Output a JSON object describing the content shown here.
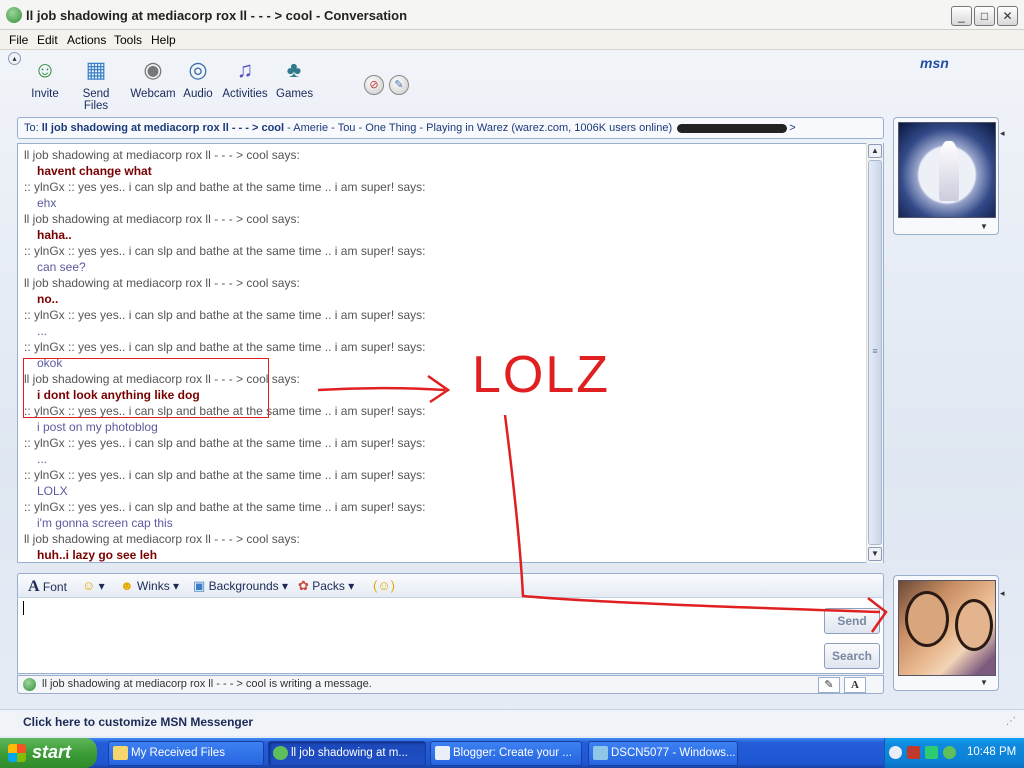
{
  "window": {
    "title": "ll job shadowing at mediacorp rox ll  - - - > cool - Conversation"
  },
  "menu": [
    "File",
    "Edit",
    "Actions",
    "Tools",
    "Help"
  ],
  "toolbar": {
    "items": [
      {
        "label": "Invite",
        "icon": "invite-icon"
      },
      {
        "label": "Send Files",
        "icon": "send-files-icon"
      },
      {
        "label": "Webcam",
        "icon": "webcam-icon"
      },
      {
        "label": "Audio",
        "icon": "audio-icon"
      },
      {
        "label": "Activities",
        "icon": "activities-icon"
      },
      {
        "label": "Games",
        "icon": "games-icon"
      }
    ],
    "logo": "msn"
  },
  "to_bar": {
    "prefix": "To:",
    "name": "ll job shadowing at mediacorp rox ll  - - - > cool",
    "rest": "- Amerie - Tou - One Thing - Playing in Warez (warez.com, 1006K users online)"
  },
  "conversation": [
    {
      "sender": "ll job shadowing at mediacorp rox ll - - - > cool says:",
      "text": "havent change what",
      "bold": true
    },
    {
      "sender": ":: ylnGx :: yes yes.. i can slp and bathe at the same time .. i am super! says:",
      "text": "ehx",
      "bold": false
    },
    {
      "sender": "ll job shadowing at mediacorp rox ll - - - > cool says:",
      "text": "haha..",
      "bold": true
    },
    {
      "sender": ":: ylnGx :: yes yes.. i can slp and bathe at the same time .. i am super! says:",
      "text": "can see?",
      "bold": false
    },
    {
      "sender": "ll job shadowing at mediacorp rox ll - - - > cool says:",
      "text": "no..",
      "bold": true
    },
    {
      "sender": ":: ylnGx :: yes yes.. i can slp and bathe at the same time .. i am super! says:",
      "text": "...",
      "bold": false
    },
    {
      "sender": ":: ylnGx :: yes yes.. i can slp and bathe at the same time .. i am super! says:",
      "text": "okok",
      "bold": false
    },
    {
      "sender": "ll job shadowing at mediacorp rox ll - - - > cool says:",
      "text": "i dont look anything like dog",
      "bold": true
    },
    {
      "sender": ":: ylnGx :: yes yes.. i can slp and bathe at the same time .. i am super! says:",
      "text": "i post on my photoblog",
      "bold": false
    },
    {
      "sender": ":: ylnGx :: yes yes.. i can slp and bathe at the same time .. i am super! says:",
      "text": "...",
      "bold": false
    },
    {
      "sender": ":: ylnGx :: yes yes.. i can slp and bathe at the same time .. i am super! says:",
      "text": "LOLX",
      "bold": false
    },
    {
      "sender": ":: ylnGx :: yes yes.. i can slp and bathe at the same time .. i am super! says:",
      "text": "i'm gonna screen cap this",
      "bold": false
    },
    {
      "sender": "ll job shadowing at mediacorp rox ll - - - > cool says:",
      "text": "huh..i lazy go see leh",
      "bold": true
    }
  ],
  "format_bar": {
    "font": "Font",
    "winks": "Winks",
    "backgrounds": "Backgrounds",
    "packs": "Packs"
  },
  "input": {
    "value": "",
    "send": "Send",
    "search": "Search"
  },
  "status": "ll job shadowing at mediacorp rox ll  - - - > cool is writing a message.",
  "customize": "Click here to customize MSN Messenger",
  "taskbar": {
    "start": "start",
    "tasks": [
      "My Received Files",
      "ll job shadowing at m...",
      "Blogger: Create your ...",
      "DSCN5077 - Windows..."
    ],
    "clock": "10:48 PM"
  },
  "annotation": {
    "text": "LOLZ",
    "color": "#e02020"
  },
  "colors": {
    "sender_bold": "#7a0000",
    "sender_norm": "#5a5aa0",
    "taskbar": "#245edb",
    "start": "#3c9d37"
  }
}
